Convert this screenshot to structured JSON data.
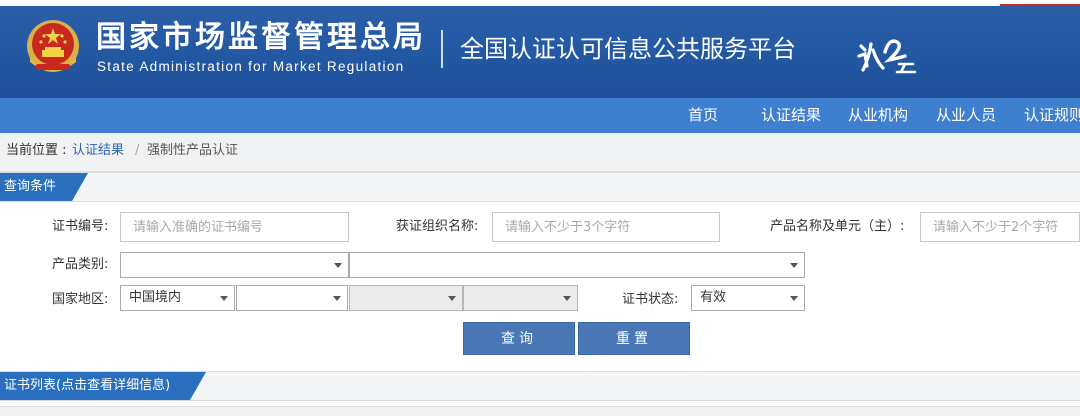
{
  "header": {
    "org_name_cn": "国家市场监督管理总局",
    "org_name_en": "State Administration  for  Market Regulation",
    "platform_title": "全国认证认可信息公共服务平台"
  },
  "nav": {
    "items": [
      "首页",
      "认证结果",
      "从业机构",
      "从业人员",
      "认证规则"
    ]
  },
  "breadcrumb": {
    "label": "当前位置 :",
    "link": "认证结果",
    "separator": "/",
    "current": "强制性产品认证"
  },
  "query_section": {
    "title": "查询条件"
  },
  "form": {
    "cert_no_label": "证书编号:",
    "cert_no_placeholder": "请输入准确的证书编号",
    "org_name_label": "获证组织名称:",
    "org_name_placeholder": "请输入不少于3个字符",
    "product_name_label": "产品名称及单元（主）:",
    "product_name_placeholder": "请输入不少于2个字符",
    "category_label": "产品类别:",
    "region_label": "国家地区:",
    "region_value": "中国境内",
    "status_label": "证书状态:",
    "status_value": "有效",
    "search_button": "查询",
    "reset_button": "重置"
  },
  "list_section": {
    "title": "证书列表(点击查看详细信息)"
  },
  "colors": {
    "banner": "#2358a3",
    "nav": "#3f7fd0",
    "button": "#4a77b5",
    "link": "#2a66b5"
  }
}
